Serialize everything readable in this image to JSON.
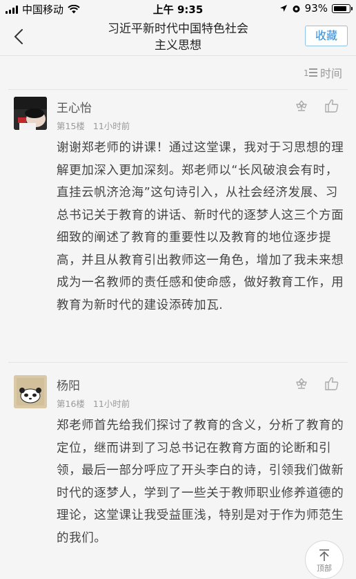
{
  "status_bar": {
    "carrier": "中国移动",
    "time": "上午 9:35",
    "battery": "93%",
    "icons": [
      "signal-icon",
      "wifi-icon",
      "location-icon",
      "alarm-icon",
      "battery-icon"
    ]
  },
  "nav": {
    "title_line1": "习近平新时代中国特色社会",
    "title_line2": "主义思想",
    "favorite_label": "收藏",
    "accent_color": "#2d8ad8"
  },
  "sort": {
    "label": "时间"
  },
  "comments": [
    {
      "username": "王心怡",
      "floor": "第15楼",
      "time_ago": "11小时前",
      "text": "谢谢郑老师的讲课！通过这堂课，我对于习思想的理解更加深入更加深刻。郑老师以“长风破浪会有时，直挂云帆济沧海”这句诗引入，从社会经济发展、习总书记关于教育的讲话、新时代的逐梦人这三个方面细致的阐述了教育的重要性以及教育的地位逐步提高，并且从教育引出教师这一角色，增加了我未来想成为一名教师的责任感和使命感，做好教育工作，用教育为新时代的建设添砖加瓦."
    },
    {
      "username": "杨阳",
      "floor": "第16楼",
      "time_ago": "11小时前",
      "text": "郑老师首先给我们探讨了教育的含义，分析了教育的定位，继而讲到了习总书记在教育方面的论断和引领，最后一部分呼应了开头李白的诗，引领我们做新时代的逐梦人，学到了一些关于教师职业修养道德的理论，这堂课让我受益匪浅，特别是对于作为师范生的我们。"
    }
  ],
  "top_button": {
    "label": "顶部"
  }
}
